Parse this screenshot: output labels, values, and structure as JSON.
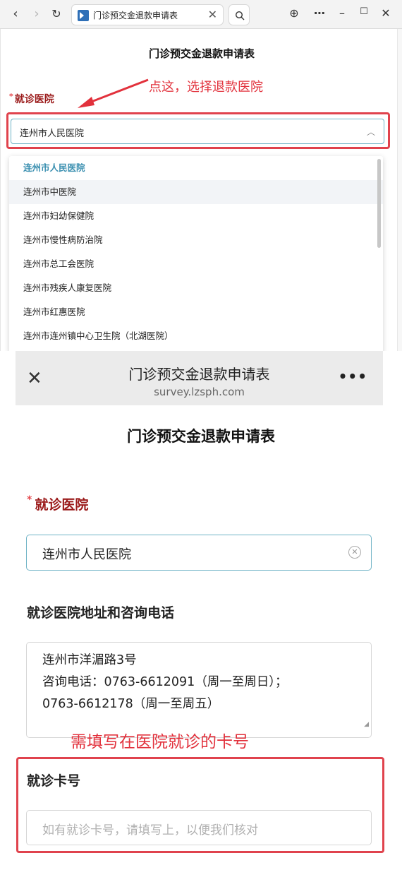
{
  "browser": {
    "tab_title": "门诊预交金退款申请表",
    "nav": {
      "back": "‹",
      "forward": "›",
      "reload": "↻"
    }
  },
  "desktop_form": {
    "title": "门诊预交金退款申请表",
    "required_mark": "*",
    "hospital_label": "就诊医院",
    "annotation": "点这，选择退款医院",
    "selected_hospital": "连州市人民医院",
    "hospital_options": [
      "连州市人民医院",
      "连州市中医院",
      "连州市妇幼保健院",
      "连州市慢性病防治院",
      "连州市总工会医院",
      "连州市残疾人康复医院",
      "连州市红惠医院",
      "连州市连州镇中心卫生院（北湖医院）"
    ]
  },
  "mobile": {
    "header_title": "门诊预交金退款申请表",
    "header_url": "survey.lzsph.com",
    "form_title": "门诊预交金退款申请表",
    "required_mark": "*",
    "hospital_label": "就诊医院",
    "hospital_value": "连州市人民医院",
    "address_label": "就诊医院地址和咨询电话",
    "address_lines": [
      "连州市洋湄路3号",
      "咨询电话：0763-6612091（周一至周日）；",
      "0763-6612178（周一至周五）"
    ],
    "annotation": "需填写在医院就诊的卡号",
    "card_label": "就诊卡号",
    "card_placeholder": "如有就诊卡号，请填写上，以便我们核对"
  },
  "colors": {
    "annotation_red": "#e2313c",
    "label_dark_red": "#9b1b1b",
    "focus_border": "#6fb3c6",
    "selected_option": "#3a8fb0"
  }
}
